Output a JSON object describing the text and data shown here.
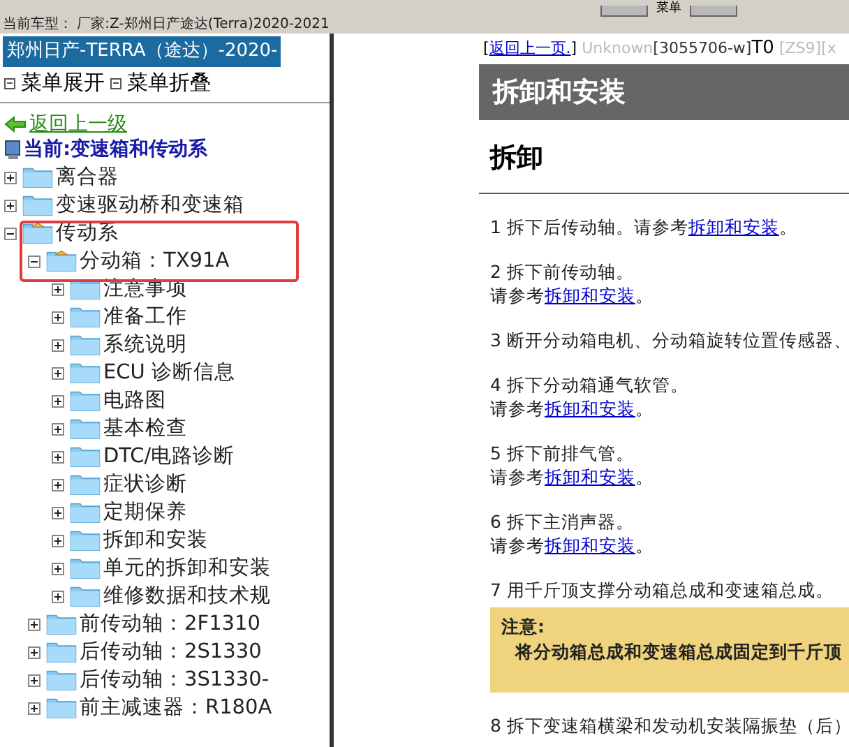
{
  "toolbar": {
    "label": "菜单"
  },
  "status_line": "当前车型： 厂家:Z-郑州日产途达(Terra)2020-2021",
  "sidebar": {
    "title": "郑州日产-TERRA（途达）-2020-",
    "actions": [
      "菜单展开",
      "菜单折叠"
    ],
    "back_link": "返回上一级",
    "current": "当前:变速箱和传动系",
    "tree": [
      {
        "label": "离合器",
        "expanded": false
      },
      {
        "label": "变速驱动桥和变速箱",
        "expanded": false
      },
      {
        "label": "传动系",
        "expanded": true,
        "children": [
          {
            "label": "分动箱：TX91A",
            "expanded": true,
            "children": [
              {
                "label": "注意事项",
                "expanded": false
              },
              {
                "label": "准备工作",
                "expanded": false
              },
              {
                "label": "系统说明",
                "expanded": false
              },
              {
                "label": "ECU 诊断信息",
                "expanded": false
              },
              {
                "label": "电路图",
                "expanded": false
              },
              {
                "label": "基本检查",
                "expanded": false
              },
              {
                "label": "DTC/电路诊断",
                "expanded": false
              },
              {
                "label": "症状诊断",
                "expanded": false
              },
              {
                "label": "定期保养",
                "expanded": false
              },
              {
                "label": "拆卸和安装",
                "expanded": false
              },
              {
                "label": "单元的拆卸和安装",
                "expanded": false
              },
              {
                "label": "维修数据和技术规",
                "expanded": false
              }
            ]
          },
          {
            "label": "前传动轴：2F1310",
            "expanded": false
          },
          {
            "label": "后传动轴：2S1330",
            "expanded": false
          },
          {
            "label": "后传动轴：3S1330-",
            "expanded": false
          },
          {
            "label": "前主减速器：R180A",
            "expanded": false
          }
        ]
      }
    ]
  },
  "content": {
    "back_open": "[",
    "back_link": "返回上一页.",
    "back_close": "]",
    "code_unknown": "Unknown",
    "code_id": "[3055706-w]",
    "code_t": "T0",
    "code_zs": "[ZS9][x",
    "title": "拆卸和安装",
    "section": "拆卸",
    "steps": [
      {
        "text": "1 拆下后传动轴。请参考",
        "link": "拆卸和安装",
        "suffix": "。"
      },
      {
        "text": "2 拆下前传动轴。",
        "ref": "请参考",
        "link": "拆卸和安装",
        "suffix": "。"
      },
      {
        "text": "3 断开分动箱电机、分动箱旋转位置传感器、"
      },
      {
        "text": "4 拆下分动箱通气软管。",
        "ref": "请参考",
        "link": "拆卸和安装",
        "suffix": "。"
      },
      {
        "text": "5 拆下前排气管。",
        "ref": "请参考",
        "link": "拆卸和安装",
        "suffix": "。"
      },
      {
        "text": "6 拆下主消声器。",
        "ref": "请参考",
        "link": "拆卸和安装",
        "suffix": "。"
      },
      {
        "text": "7 用千斤顶支撑分动箱总成和变速箱总成。"
      }
    ],
    "note": {
      "title": "注意:",
      "text": "将分动箱总成和变速箱总成固定到千斤顶"
    },
    "last_step": "8 拆下变速箱横梁和发动机安装隔振垫（后）"
  }
}
